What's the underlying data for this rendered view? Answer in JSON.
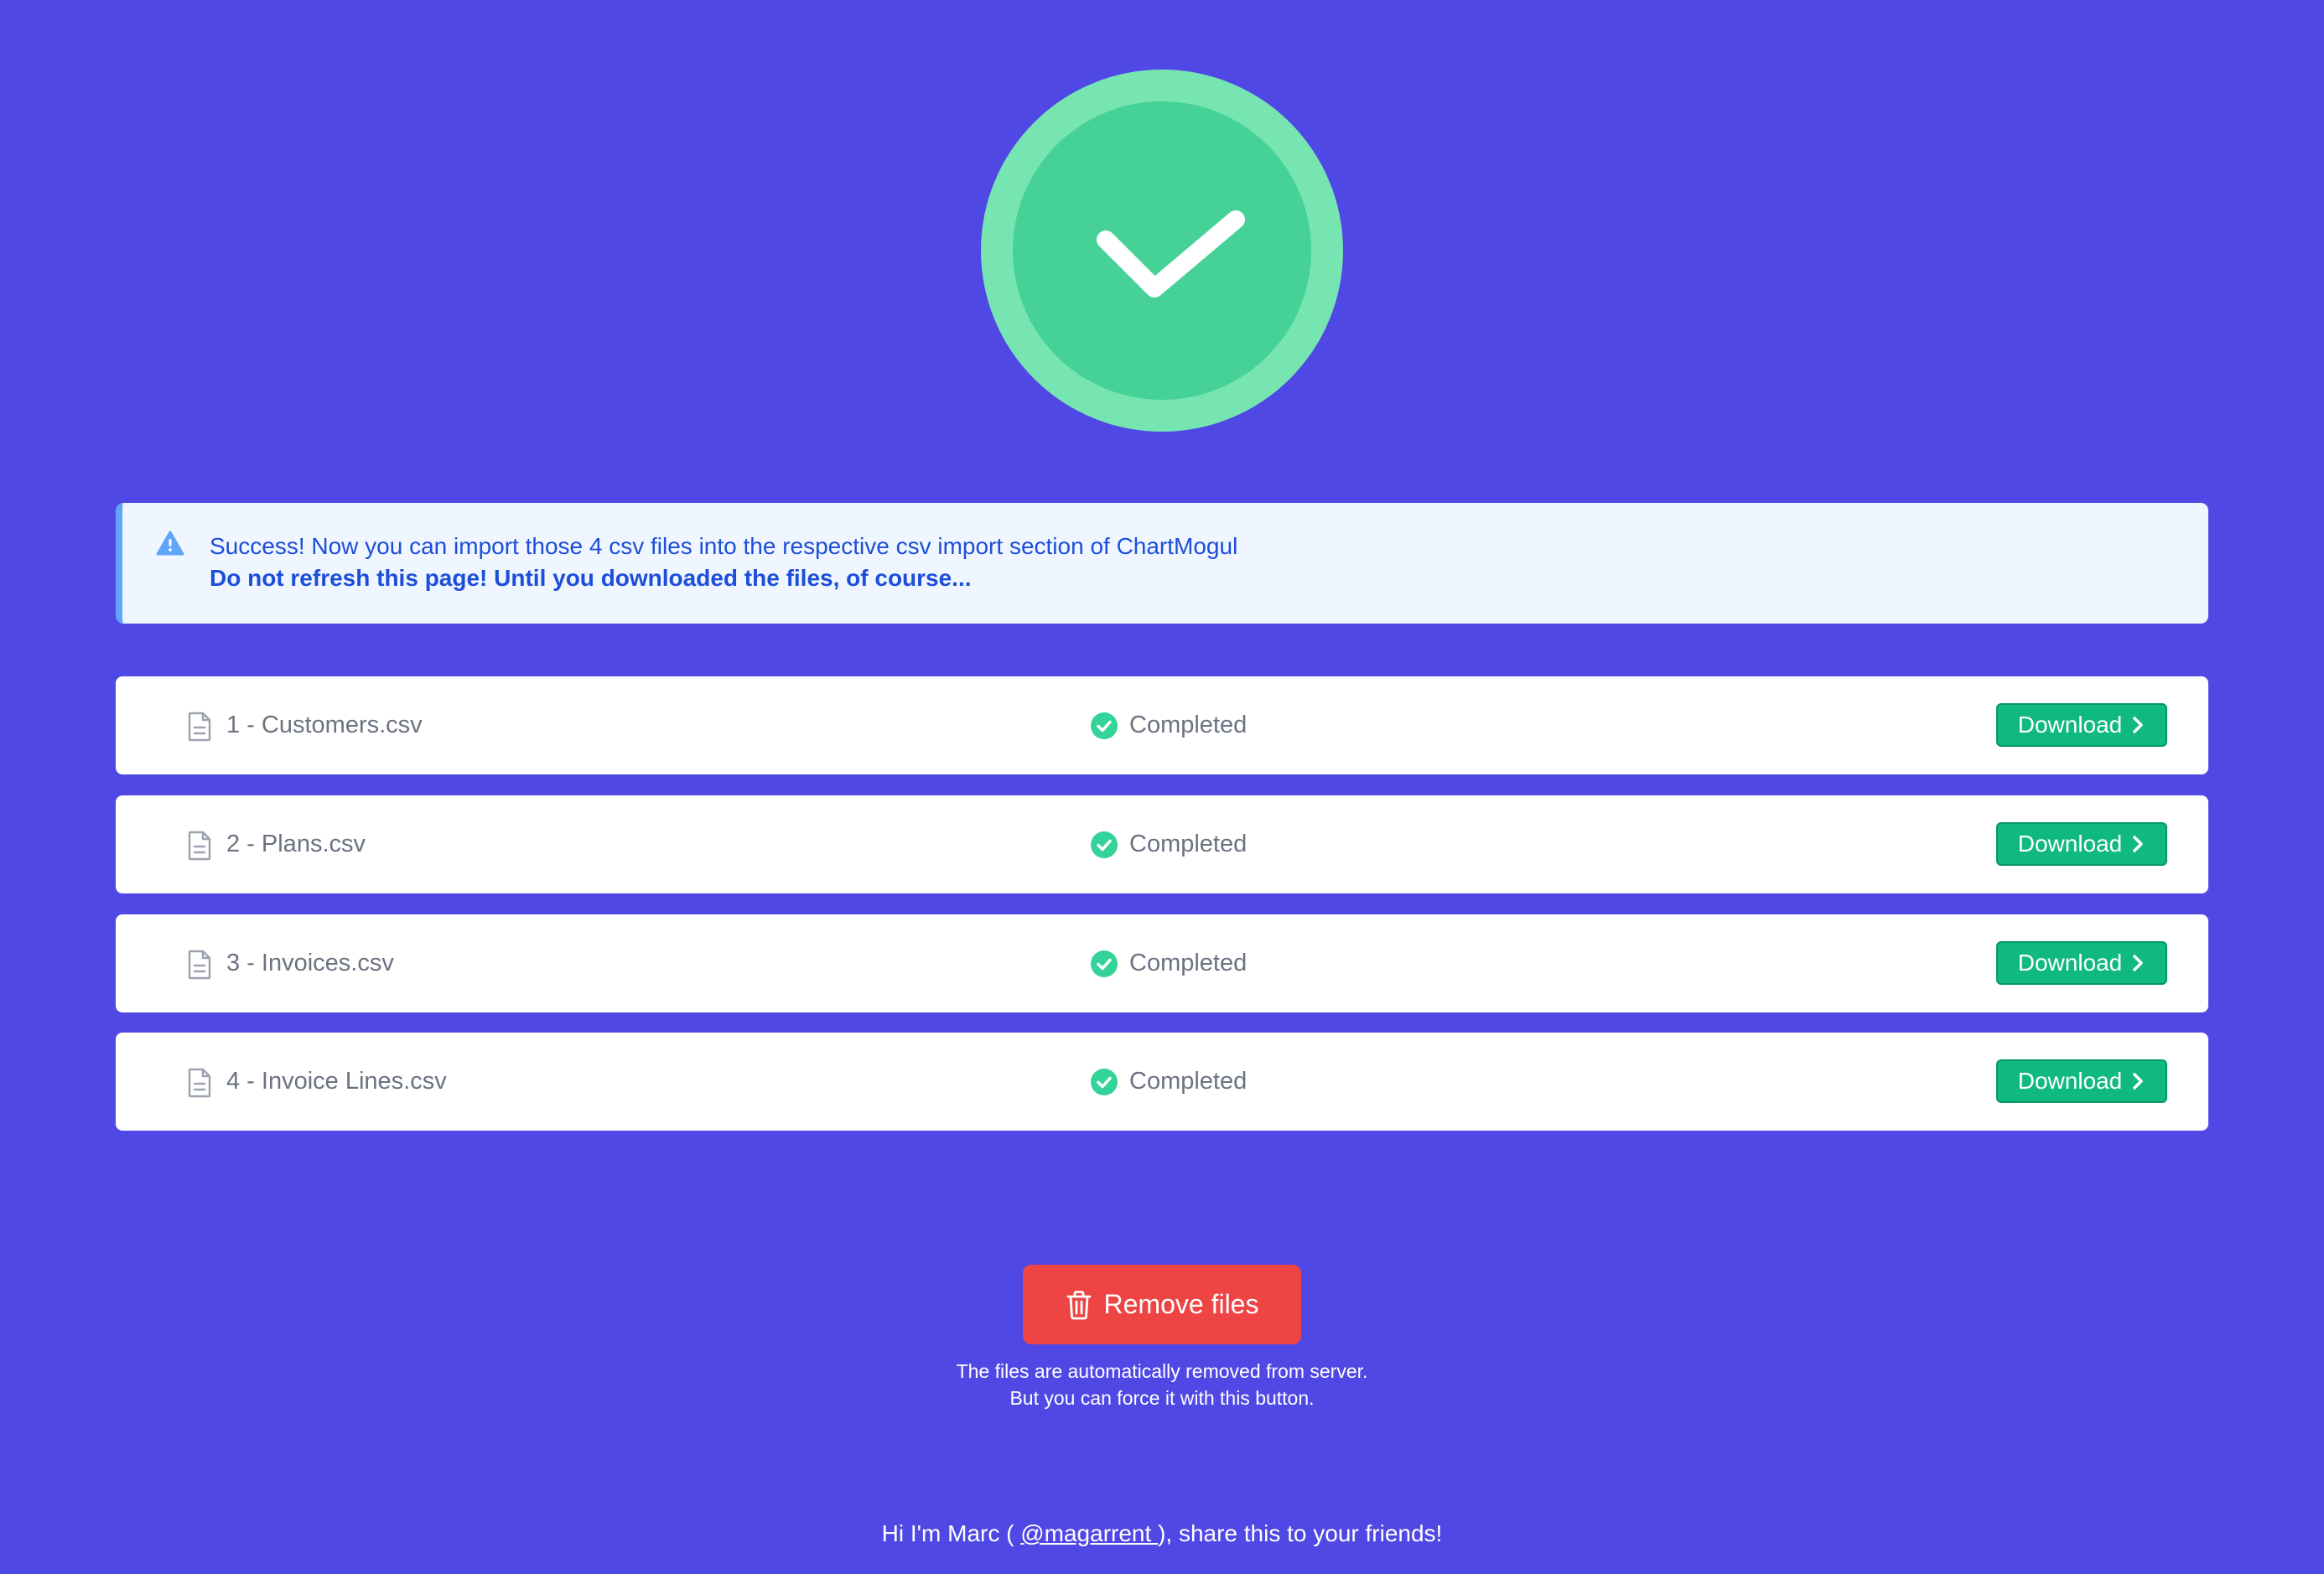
{
  "alert": {
    "line1": "Success! Now you can import those 4 csv files into the respective csv import section of ChartMogul",
    "line2": "Do not refresh this page! Until you downloaded the files, of course..."
  },
  "files": [
    {
      "name": "1 - Customers.csv",
      "status": "Completed",
      "action": "Download"
    },
    {
      "name": "2 - Plans.csv",
      "status": "Completed",
      "action": "Download"
    },
    {
      "name": "3 - Invoices.csv",
      "status": "Completed",
      "action": "Download"
    },
    {
      "name": "4 - Invoice Lines.csv",
      "status": "Completed",
      "action": "Download"
    }
  ],
  "remove": {
    "label": "Remove files",
    "note_line1": "The files are automatically removed from server.",
    "note_line2": "But you can force it with this button."
  },
  "footer": {
    "prefix": "Hi I'm Marc ( ",
    "handle": "@magarrent ",
    "suffix": "), share this to your friends!"
  },
  "colors": {
    "background": "#5048e5",
    "success": "#10b981",
    "danger": "#ef4444",
    "info": "#1d4ed8"
  },
  "icons": {
    "hero": "checkmark-icon",
    "alert": "warning-icon",
    "file": "document-icon",
    "status": "check-circle-icon",
    "action": "chevron-right-icon",
    "remove": "trash-icon"
  }
}
